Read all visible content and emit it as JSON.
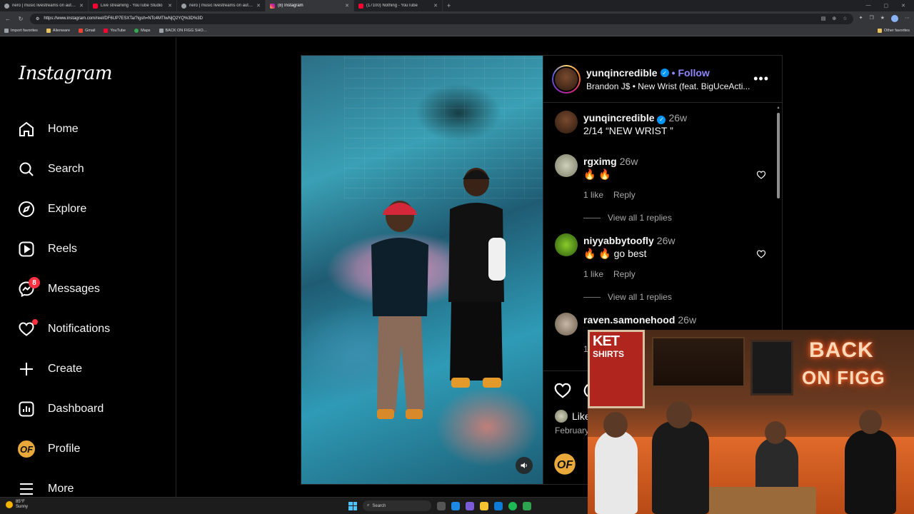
{
  "browser": {
    "tabs": [
      {
        "title": "nero | music livestreams on auto...",
        "icon": "generic",
        "active": false
      },
      {
        "title": "Live streaming - YouTube Studio",
        "icon": "youtube",
        "active": false
      },
      {
        "title": "nero | music livestreams on auto...",
        "icon": "generic",
        "active": false
      },
      {
        "title": "(8) Instagram",
        "icon": "instagram",
        "active": true
      },
      {
        "title": "(17100) Nothing - YouTube",
        "icon": "youtube",
        "active": false
      }
    ],
    "url": "https://www.instagram.com/reel/DF6UP7ESXTa/?igsh=NTc4MTIwNjQ2YQ%3D%3D",
    "bookmarks": [
      "Import favorites",
      "Alienware",
      "Gmail",
      "YouTube",
      "Maps",
      "BACK ON FIGG SHO..."
    ],
    "other_favorites": "Other favorites"
  },
  "sidebar": {
    "logo": "Instagram",
    "items": [
      {
        "label": "Home",
        "icon": "home-icon"
      },
      {
        "label": "Search",
        "icon": "search-icon"
      },
      {
        "label": "Explore",
        "icon": "compass-icon"
      },
      {
        "label": "Reels",
        "icon": "reels-icon"
      },
      {
        "label": "Messages",
        "icon": "messenger-icon",
        "badge": "8"
      },
      {
        "label": "Notifications",
        "icon": "heart-icon",
        "dot": true
      },
      {
        "label": "Create",
        "icon": "plus-icon"
      },
      {
        "label": "Dashboard",
        "icon": "dashboard-icon"
      },
      {
        "label": "Profile",
        "icon": "profile-avatar"
      },
      {
        "label": "More",
        "icon": "menu-icon"
      }
    ]
  },
  "post": {
    "username": "yunqincredible",
    "follow_label": "Follow",
    "follow_sep": "•",
    "song": "Brandon J$ • New Wrist (feat. BigUceActi...",
    "more_label": "•••",
    "caption": {
      "user": "yunqincredible",
      "time": "26w",
      "text": "2/14 “NEW WRIST ”"
    },
    "comments": [
      {
        "user": "rgximg",
        "time": "26w",
        "text": "🔥 🔥",
        "likes": "1 like",
        "reply": "Reply",
        "view_replies": "View all 1 replies"
      },
      {
        "user": "niyyabbytoofly",
        "time": "26w",
        "text": "🔥 🔥  go best",
        "likes": "1 like",
        "reply": "Reply",
        "view_replies": "View all 1 replies"
      },
      {
        "user": "raven.samonehood",
        "time": "26w",
        "text": "",
        "likes": "1",
        "reply": "",
        "view_replies": ""
      }
    ],
    "likes_text": "Like",
    "date": "February"
  },
  "overlay": {
    "poster_line1": "KET",
    "poster_line2": "SHIRTS",
    "neon_line1": "BACK",
    "neon_line2": "ON FIGG"
  },
  "taskbar": {
    "temp": "85°F",
    "condition": "Sunny",
    "search": "Search"
  },
  "colors": {
    "follow": "#8f87ff",
    "verified": "#0095f6",
    "badge": "#ff3040"
  }
}
